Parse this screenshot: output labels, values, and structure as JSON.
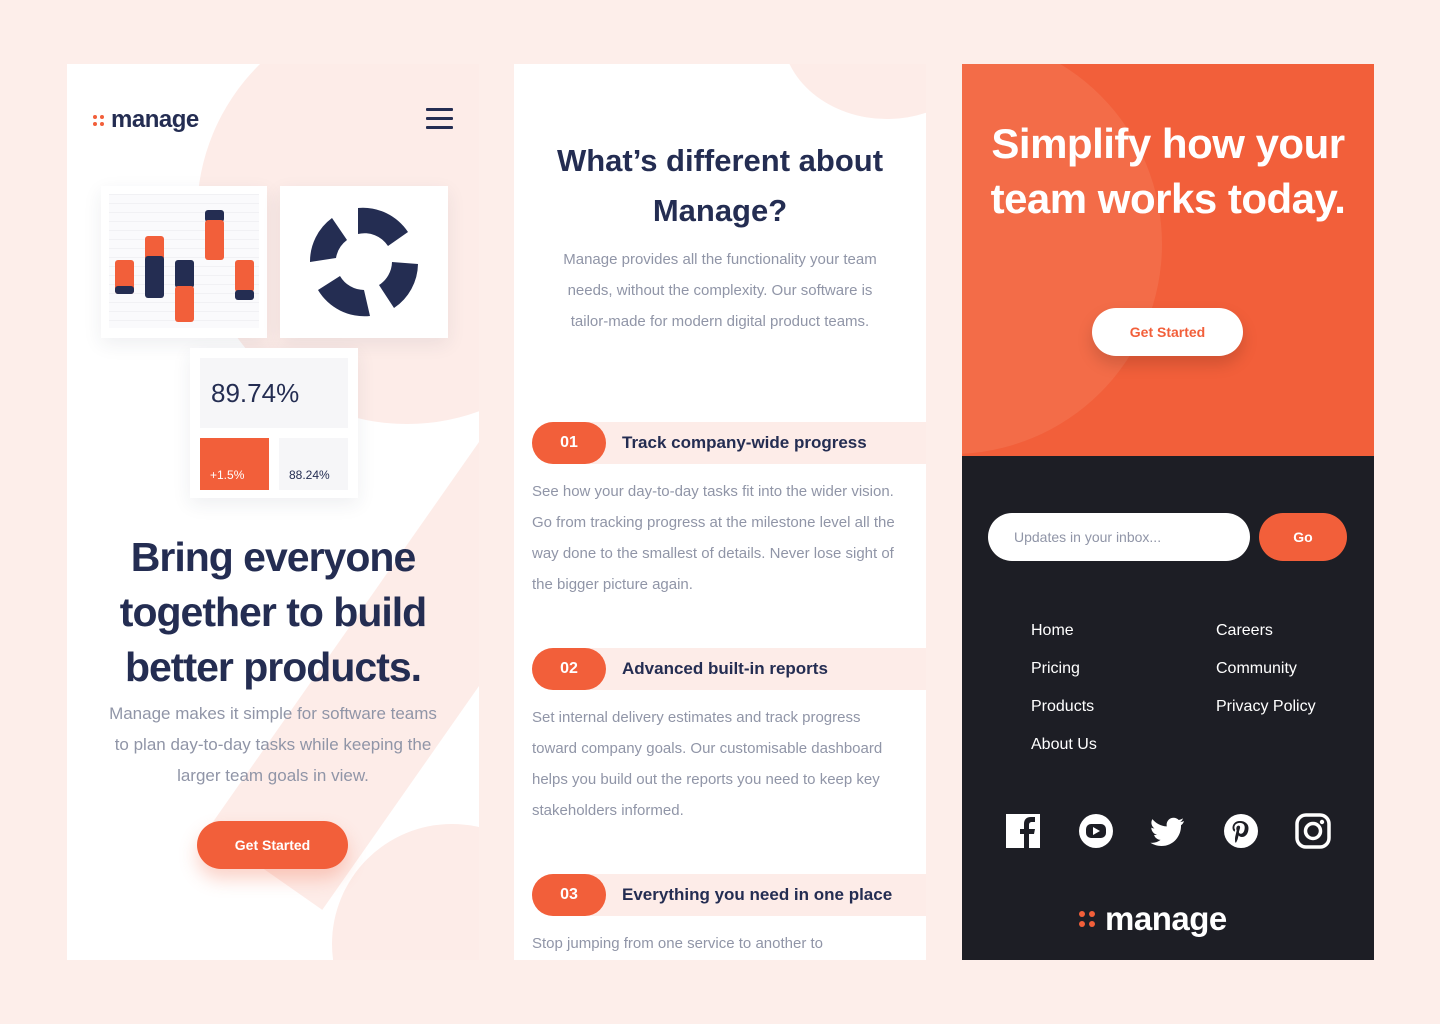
{
  "colors": {
    "accent": "#f25f3a",
    "navy": "#242d52",
    "dark": "#1d1e25",
    "blush": "#fdeeea",
    "gray_text": "#9095a7"
  },
  "panel1": {
    "logo_text": "manage",
    "menu_icon": "hamburger-icon",
    "stats": {
      "main": "89.74%",
      "change": "+1.5%",
      "secondary": "88.24%"
    },
    "hero_title": "Bring everyone together to build better products.",
    "hero_description": "Manage makes it simple for software teams to plan day-to-day tasks while keeping the larger team goals in view.",
    "cta_label": "Get Started"
  },
  "panel2": {
    "title": "What’s different about Manage?",
    "description": "Manage provides all the functionality your team needs, without the complexity. Our software is tailor-made for modern digital product teams.",
    "features": [
      {
        "number": "01",
        "title": "Track company-wide progress",
        "description": "See how your day-to-day tasks fit into the wider vision. Go from tracking progress at the milestone level all the way done to the smallest of details. Never lose sight of the bigger picture again."
      },
      {
        "number": "02",
        "title": "Advanced built-in reports",
        "description": "Set internal delivery estimates and track progress toward company goals. Our customisable dashboard helps you build out the reports you need to keep key stakeholders informed."
      },
      {
        "number": "03",
        "title": "Everything you need in one place",
        "description": "Stop jumping from one service to another to"
      }
    ]
  },
  "panel3": {
    "cta_title": "Simplify how your team works today.",
    "cta_label": "Get Started",
    "newsletter": {
      "placeholder": "Updates in your inbox...",
      "button": "Go"
    },
    "links_left": [
      "Home",
      "Pricing",
      "Products",
      "About Us"
    ],
    "links_right": [
      "Careers",
      "Community",
      "Privacy Policy"
    ],
    "socials": [
      "facebook-icon",
      "youtube-icon",
      "twitter-icon",
      "pinterest-icon",
      "instagram-icon"
    ],
    "logo_text": "manage"
  }
}
